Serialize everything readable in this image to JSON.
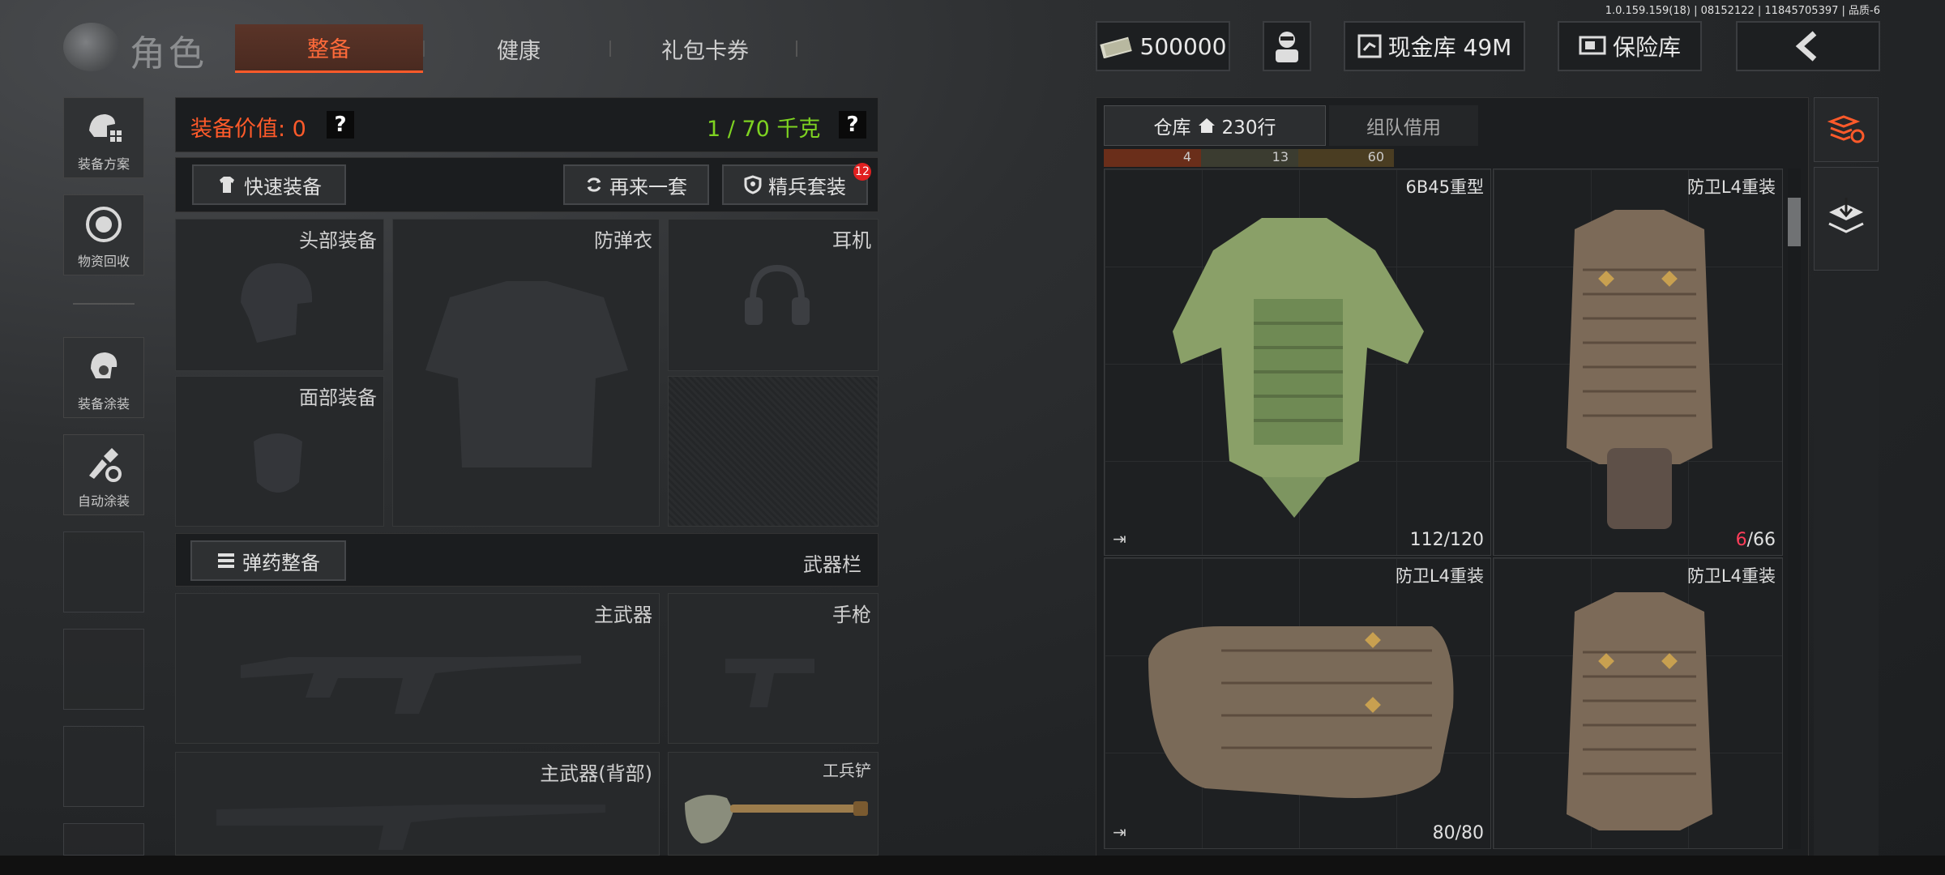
{
  "version": "1.0.159.159(18) | 08152122 | 11845705397 | 品质-6",
  "header": {
    "title": "角色",
    "tabs": [
      {
        "label": "整备",
        "active": true
      },
      {
        "label": "健康",
        "active": false
      },
      {
        "label": "礼包卡券",
        "active": false
      }
    ],
    "money": "500000",
    "cash_vault": "现金库 49M",
    "insurance": "保险库"
  },
  "sidebar": {
    "items": [
      {
        "label": "装备方案",
        "icon": "loadout-icon"
      },
      {
        "label": "物资回收",
        "icon": "recycle-icon"
      },
      {
        "label": "装备涂装",
        "icon": "helmet-paint-icon"
      },
      {
        "label": "自动涂装",
        "icon": "auto-paint-icon"
      }
    ]
  },
  "equipment": {
    "value_label": "装备价值: 0",
    "weight": "1 / 70 千克",
    "quick_equip": "快速装备",
    "redo_set": "再来一套",
    "elite_set": "精兵套装",
    "elite_badge": "12",
    "slots": {
      "head": "头部装备",
      "armor": "防弹衣",
      "headset": "耳机",
      "face": "面部装备"
    },
    "ammo_btn": "弹药整备",
    "weapon_bar": "武器栏",
    "weapons": {
      "primary": "主武器",
      "pistol": "手枪",
      "primary_back": "主武器(背部)",
      "shovel": "工兵铲"
    }
  },
  "inventory": {
    "tabs": [
      {
        "label": "仓库",
        "count": "230行",
        "active": true
      },
      {
        "label": "组队借用",
        "active": false
      }
    ],
    "top_strip": [
      "4",
      "13",
      "60"
    ],
    "items": [
      {
        "name": "6B45重型",
        "durability": "112/120",
        "color": "green"
      },
      {
        "name": "防卫L4重装",
        "durability_low": "6",
        "durability_max": "/66",
        "color": "brown"
      },
      {
        "name": "防卫L4重装",
        "durability": "80/80",
        "color": "brown"
      },
      {
        "name": "防卫L4重装",
        "durability": "",
        "color": "brown"
      }
    ]
  },
  "colors": {
    "accent": "#ff5a2a",
    "green_text": "#7ed321",
    "red_text": "#ff3d5a"
  }
}
